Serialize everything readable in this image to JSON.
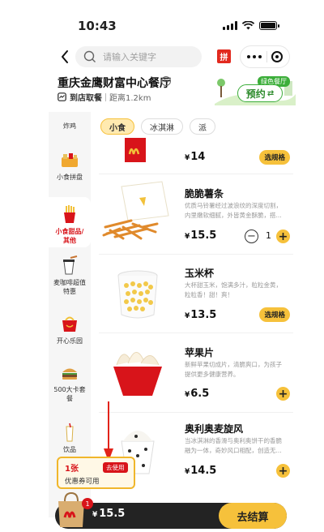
{
  "status_bar": {
    "time": "10:43"
  },
  "nav": {
    "search_placeholder": "请输入关键字",
    "pin_badge": "拼"
  },
  "store": {
    "name": "重庆金鹰财富中心餐厅",
    "mode": "到店取餐",
    "distance": "距离1.2km",
    "promo_tag": "绿色餐厅",
    "reserve_label": "预约"
  },
  "sidebar": {
    "items": [
      {
        "label": "炸鸡",
        "icon": "fried-chicken-icon"
      },
      {
        "label": "小食拼盘",
        "icon": "snack-platter-icon"
      },
      {
        "label": "小食甜品/其他",
        "icon": "fries-icon",
        "active": true
      },
      {
        "label": "麦咖啡超值特惠",
        "icon": "coffee-icon"
      },
      {
        "label": "开心乐园",
        "icon": "happy-meal-icon"
      },
      {
        "label": "500大卡套餐",
        "icon": "burger-meal-icon"
      },
      {
        "label": "饮品",
        "icon": "drink-icon"
      }
    ]
  },
  "tabs": [
    {
      "label": "小食",
      "active": true
    },
    {
      "label": "冰淇淋"
    },
    {
      "label": "派"
    }
  ],
  "products": [
    {
      "name": "",
      "desc": "",
      "price": "14",
      "action": "选规格"
    },
    {
      "name": "脆脆薯条",
      "desc": "优质马铃薯经过波浪纹的深度切割，内里嫩软细腻，外皆黄金酥脆，搭...",
      "price": "15.5",
      "qty": "1"
    },
    {
      "name": "玉米杯",
      "desc": "大杯甜玉米，饱满多汁，粒粒金黄，粒粒香！甜！爽！",
      "price": "13.5",
      "action": "选规格"
    },
    {
      "name": "苹果片",
      "desc": "新鲜苹果切成片，清脆爽口，为孩子提供更多健康营养。",
      "price": "6.5"
    },
    {
      "name": "奥利奥麦旋风",
      "desc": "当冰淇淋的香滑与奥利奥饼干的香脆融为一体，奇妙风口相配，创造无...",
      "price": "14.5"
    }
  ],
  "coupon": {
    "count": "1张",
    "use_label": "去使用",
    "available": "优惠券可用"
  },
  "cart": {
    "badge": "1",
    "total": "15.5",
    "currency": "¥",
    "checkout_label": "去结算"
  },
  "colors": {
    "brand_red": "#d8141a",
    "brand_yellow": "#f6c13b",
    "green": "#3cae3a",
    "bar_dark": "#232323"
  }
}
